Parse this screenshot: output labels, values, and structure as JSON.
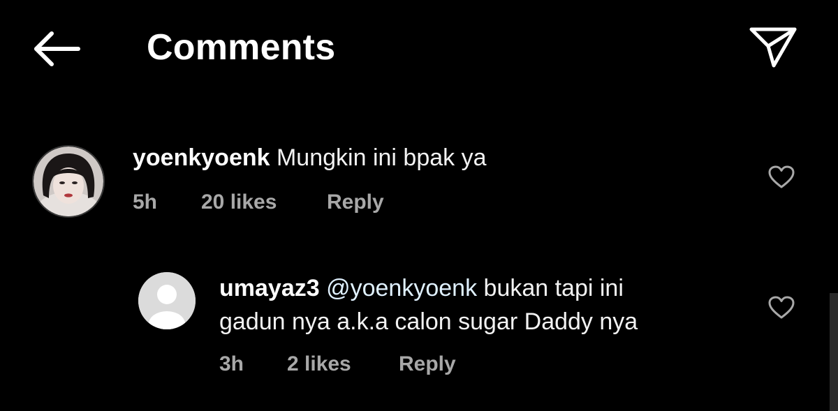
{
  "header": {
    "back_icon": "arrow-left-icon",
    "title": "Comments",
    "share_icon": "paper-plane-icon"
  },
  "comments": [
    {
      "username": "yoenkyoenk",
      "text": "Mungkin ini bpak ya",
      "time": "5h",
      "likes": "20 likes",
      "reply_label": "Reply",
      "like_icon": "heart-outline-icon",
      "avatar": "profile-photo"
    }
  ],
  "replies": [
    {
      "username": "umayaz3",
      "mention": "@yoenkyoenk",
      "text_line1": "bukan tapi ini",
      "text_line2": "gadun nya a.k.a calon sugar Daddy nya",
      "time": "3h",
      "likes": "2 likes",
      "reply_label": "Reply",
      "like_icon": "heart-outline-icon",
      "avatar": "default-avatar-icon"
    }
  ],
  "colors": {
    "background": "#000000",
    "primary_text": "#ffffff",
    "secondary_text": "#a8a8a8",
    "mention": "#e0f1ff"
  }
}
